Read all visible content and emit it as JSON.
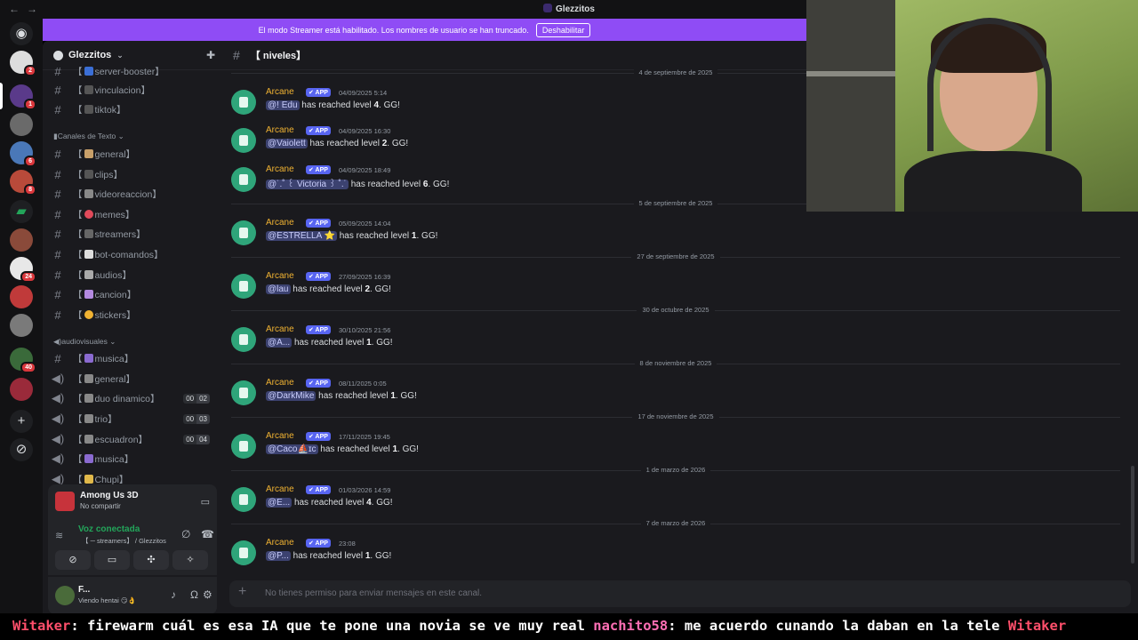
{
  "window": {
    "title": "Glezzitos"
  },
  "banner": {
    "text": "El modo Streamer está habilitado. Los nombres de usuario se han truncado.",
    "button": "Deshabilitar"
  },
  "server": {
    "name": "Glezzitos"
  },
  "rail_badges": [
    "2",
    "1",
    "6",
    "8",
    "24",
    "40"
  ],
  "channels": [
    {
      "kind": "text",
      "name": "server-booster",
      "prefix": "【",
      "suffix": "】"
    },
    {
      "kind": "text",
      "name": "vinculacion",
      "prefix": "【",
      "suffix": "】"
    },
    {
      "kind": "text",
      "name": "tiktok",
      "prefix": "【",
      "suffix": "】"
    }
  ],
  "categories": {
    "text": "Canales de Texto",
    "av": "audiovisuales"
  },
  "text_channels": [
    "general】",
    "clips】",
    "videoreaccion】",
    "memes】",
    "streamers】",
    "bot-comandos】",
    "audios】",
    "cancion】",
    "stickers】"
  ],
  "av_channels": [
    {
      "name": "musica】",
      "kind": "text"
    },
    {
      "name": "general】",
      "kind": "voice"
    },
    {
      "name": "duo dinamico】",
      "kind": "voice",
      "a": "00",
      "b": "02"
    },
    {
      "name": "trio】",
      "kind": "voice",
      "a": "00",
      "b": "03"
    },
    {
      "name": "escuadron】",
      "kind": "voice",
      "a": "00",
      "b": "04"
    },
    {
      "name": "musica】",
      "kind": "voice"
    },
    {
      "name": "Chupi】",
      "kind": "voice"
    }
  ],
  "activity": {
    "game": "Among Us 3D",
    "status": "No compartir"
  },
  "voice": {
    "status": "Voz conectada",
    "channel": "【 ─ streamers】 / Glezzitos"
  },
  "user": {
    "name": "F...",
    "status": "Viendo hentai 😏👌"
  },
  "channel_header": {
    "name": "【 niveles】"
  },
  "messages": [
    {
      "date": "4 de septiembre de 2025",
      "time": "04/09/2025 5:14",
      "mention": "@! Edu",
      "level": "4"
    },
    {
      "date": "",
      "time": "04/09/2025 16:30",
      "mention": "@Vaiolett",
      "level": "2"
    },
    {
      "date": "",
      "time": "04/09/2025 18:49",
      "mention": "@˙.˚ ꒰ Victoria ꒱ ˚.˙",
      "level": "6"
    },
    {
      "date": "5 de septiembre de 2025",
      "time": "05/09/2025 14:04",
      "mention": "@ESTRELLA ⭐",
      "level": "1"
    },
    {
      "date": "27 de septiembre de 2025",
      "time": "27/09/2025 16:39",
      "mention": "@lau",
      "level": "2"
    },
    {
      "date": "30 de octubre de 2025",
      "time": "30/10/2025 21:56",
      "mention": "@A...",
      "level": "1"
    },
    {
      "date": "8 de noviembre de 2025",
      "time": "08/11/2025 0:05",
      "mention": "@DarkMike",
      "level": "1"
    },
    {
      "date": "17 de noviembre de 2025",
      "time": "17/11/2025 19:45",
      "mention": "@Caco⛵ɪc",
      "level": "1"
    },
    {
      "date": "1 de marzo de 2026",
      "time": "01/03/2026 14:59",
      "mention": "@E...",
      "level": "4"
    },
    {
      "date": "7 de marzo de 2026",
      "time": "23:08",
      "mention": "@P...",
      "level": "1"
    }
  ],
  "bot": {
    "name": "Arcane",
    "tag": "✔ APP",
    "text_pre": "has reached level",
    "text_post": ". GG!"
  },
  "composer": {
    "placeholder": "No tienes permiso para enviar mensajes en este canal."
  },
  "ticker": [
    {
      "user": "Witaker",
      "text": ": firewarm cuál es esa IA que te pone una novia se ve muy real "
    },
    {
      "user": "nachito58",
      "text": ": me acuerdo cunando la daban en la tele "
    },
    {
      "user": "Witaker",
      "text": ""
    }
  ]
}
